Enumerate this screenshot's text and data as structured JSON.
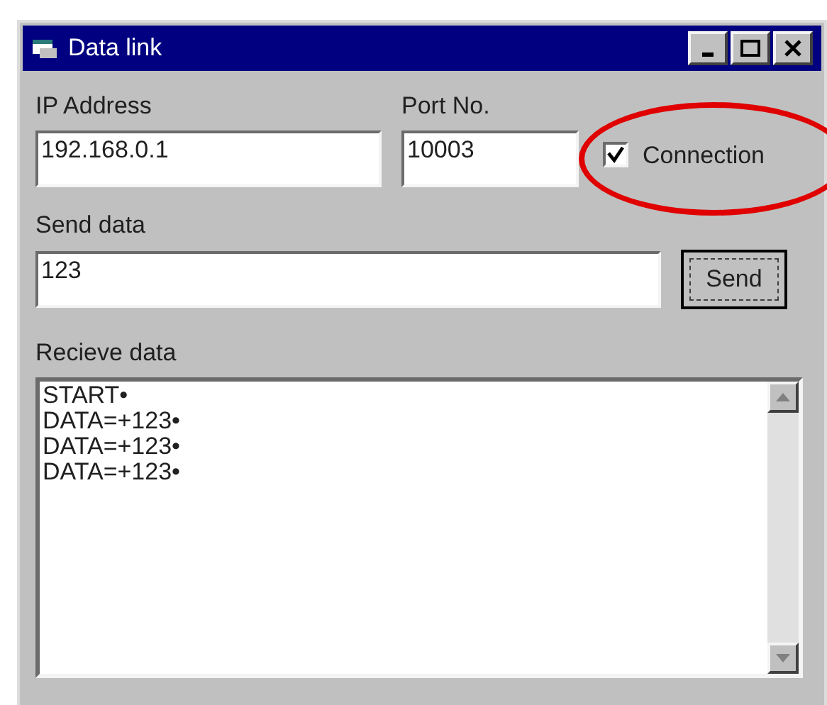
{
  "window": {
    "title": "Data link"
  },
  "ip_address": {
    "label": "IP Address",
    "value": "192.168.0.1"
  },
  "port": {
    "label": "Port No.",
    "value": "10003"
  },
  "connection": {
    "label": "Connection",
    "checked": true,
    "highlighted": true
  },
  "send_data": {
    "label": "Send data",
    "value": "123"
  },
  "send_button": "Send",
  "receive_data": {
    "label": "Recieve data",
    "lines": [
      "START•",
      "DATA=+123•",
      "DATA=+123•",
      "DATA=+123•"
    ]
  }
}
